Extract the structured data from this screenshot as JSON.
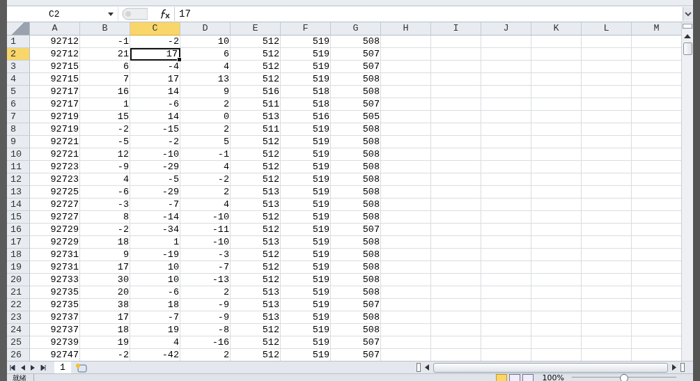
{
  "formula_bar": {
    "name_box": "C2",
    "formula": "17"
  },
  "columns": [
    {
      "label": "A",
      "selected": false
    },
    {
      "label": "B",
      "selected": false
    },
    {
      "label": "C",
      "selected": true
    },
    {
      "label": "D",
      "selected": false
    },
    {
      "label": "E",
      "selected": false
    },
    {
      "label": "F",
      "selected": false
    },
    {
      "label": "G",
      "selected": false
    },
    {
      "label": "H",
      "selected": false
    },
    {
      "label": "I",
      "selected": false
    },
    {
      "label": "J",
      "selected": false
    },
    {
      "label": "K",
      "selected": false
    },
    {
      "label": "L",
      "selected": false
    },
    {
      "label": "M",
      "selected": false
    }
  ],
  "rows": [
    {
      "number": "1",
      "selected": false,
      "cells": [
        "92712",
        "-1",
        "-2",
        "10",
        "512",
        "519",
        "508"
      ]
    },
    {
      "number": "2",
      "selected": true,
      "cells": [
        "92712",
        "21",
        "17",
        "6",
        "512",
        "519",
        "507"
      ]
    },
    {
      "number": "3",
      "selected": false,
      "cells": [
        "92715",
        "6",
        "-4",
        "4",
        "512",
        "519",
        "507"
      ]
    },
    {
      "number": "4",
      "selected": false,
      "cells": [
        "92715",
        "7",
        "17",
        "13",
        "512",
        "519",
        "508"
      ]
    },
    {
      "number": "5",
      "selected": false,
      "cells": [
        "92717",
        "16",
        "14",
        "9",
        "516",
        "518",
        "508"
      ]
    },
    {
      "number": "6",
      "selected": false,
      "cells": [
        "92717",
        "1",
        "-6",
        "2",
        "511",
        "518",
        "507"
      ]
    },
    {
      "number": "7",
      "selected": false,
      "cells": [
        "92719",
        "15",
        "14",
        "0",
        "513",
        "516",
        "505"
      ]
    },
    {
      "number": "8",
      "selected": false,
      "cells": [
        "92719",
        "-2",
        "-15",
        "2",
        "511",
        "519",
        "508"
      ]
    },
    {
      "number": "9",
      "selected": false,
      "cells": [
        "92721",
        "-5",
        "-2",
        "5",
        "512",
        "519",
        "508"
      ]
    },
    {
      "number": "10",
      "selected": false,
      "cells": [
        "92721",
        "12",
        "-10",
        "-1",
        "512",
        "519",
        "508"
      ]
    },
    {
      "number": "11",
      "selected": false,
      "cells": [
        "92723",
        "-9",
        "-29",
        "4",
        "512",
        "519",
        "508"
      ]
    },
    {
      "number": "12",
      "selected": false,
      "cells": [
        "92723",
        "4",
        "-5",
        "-2",
        "512",
        "519",
        "508"
      ]
    },
    {
      "number": "13",
      "selected": false,
      "cells": [
        "92725",
        "-6",
        "-29",
        "2",
        "513",
        "519",
        "508"
      ]
    },
    {
      "number": "14",
      "selected": false,
      "cells": [
        "92727",
        "-3",
        "-7",
        "4",
        "513",
        "519",
        "508"
      ]
    },
    {
      "number": "15",
      "selected": false,
      "cells": [
        "92727",
        "8",
        "-14",
        "-10",
        "512",
        "519",
        "508"
      ]
    },
    {
      "number": "16",
      "selected": false,
      "cells": [
        "92729",
        "-2",
        "-34",
        "-11",
        "512",
        "519",
        "507"
      ]
    },
    {
      "number": "17",
      "selected": false,
      "cells": [
        "92729",
        "18",
        "1",
        "-10",
        "513",
        "519",
        "508"
      ]
    },
    {
      "number": "18",
      "selected": false,
      "cells": [
        "92731",
        "9",
        "-19",
        "-3",
        "512",
        "519",
        "508"
      ]
    },
    {
      "number": "19",
      "selected": false,
      "cells": [
        "92731",
        "17",
        "10",
        "-7",
        "512",
        "519",
        "508"
      ]
    },
    {
      "number": "20",
      "selected": false,
      "cells": [
        "92733",
        "30",
        "10",
        "-13",
        "512",
        "519",
        "508"
      ]
    },
    {
      "number": "21",
      "selected": false,
      "cells": [
        "92735",
        "20",
        "-6",
        "2",
        "513",
        "519",
        "508"
      ]
    },
    {
      "number": "22",
      "selected": false,
      "cells": [
        "92735",
        "38",
        "18",
        "-9",
        "513",
        "519",
        "507"
      ]
    },
    {
      "number": "23",
      "selected": false,
      "cells": [
        "92737",
        "17",
        "-7",
        "-9",
        "513",
        "519",
        "508"
      ]
    },
    {
      "number": "24",
      "selected": false,
      "cells": [
        "92737",
        "18",
        "19",
        "-8",
        "512",
        "519",
        "508"
      ]
    },
    {
      "number": "25",
      "selected": false,
      "cells": [
        "92739",
        "19",
        "4",
        "-16",
        "512",
        "519",
        "507"
      ]
    },
    {
      "number": "26",
      "selected": false,
      "cells": [
        "92747",
        "-2",
        "-42",
        "2",
        "512",
        "519",
        "507"
      ]
    }
  ],
  "sheet_tabs": [
    {
      "label": "1",
      "selected": true
    }
  ],
  "status_bar": {
    "status": "就绪",
    "zoom": "100%",
    "zoom_slider": {
      "level": 0.5
    }
  }
}
